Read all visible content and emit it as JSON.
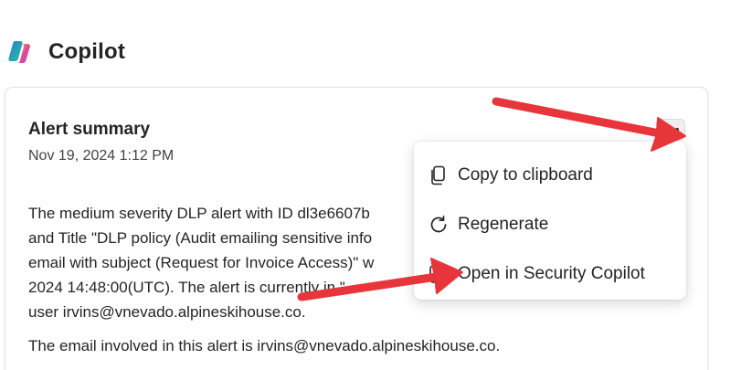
{
  "app": {
    "title": "Copilot"
  },
  "card": {
    "title": "Alert summary",
    "timestamp": "Nov 19, 2024 1:12 PM",
    "summary_lines": [
      "The medium severity DLP alert with ID dl3e6607b",
      "and Title \"DLP policy (Audit emailing sensitive info",
      "email with subject (Request for Invoice Access)\" w",
      "2024 14:48:00(UTC). The alert is currently in \"",
      "user irvins@vnevado.alpineskihouse.co."
    ],
    "email_line": "The email involved in this alert is irvins@vnevado.alpineskihouse.co."
  },
  "more_button": {
    "icon": "more-horizontal-icon"
  },
  "menu": {
    "items": [
      {
        "label": "Copy to clipboard",
        "icon": "copy-icon"
      },
      {
        "label": "Regenerate",
        "icon": "regenerate-icon"
      },
      {
        "label": "Open in Security Copilot",
        "icon": "open-external-icon"
      }
    ]
  },
  "colors": {
    "text_primary": "#242424",
    "card_border": "#e4e4e4",
    "annotation_arrow": "#e8353b",
    "menu_background": "#ffffff"
  }
}
